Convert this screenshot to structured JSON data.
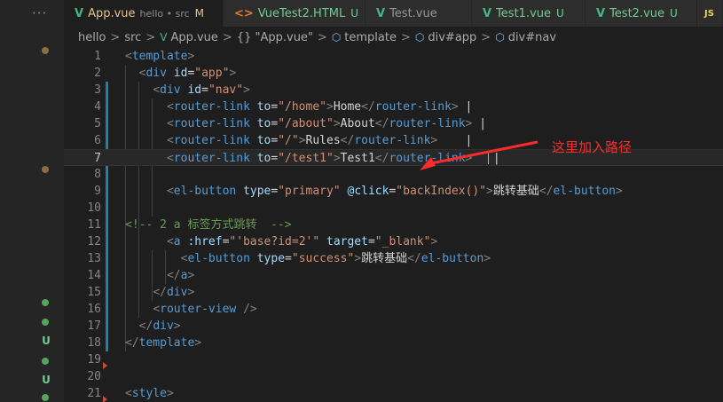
{
  "explorer_strip": {
    "more_dots": "···",
    "status_letters": [
      "U",
      "U"
    ]
  },
  "tabs": [
    {
      "name": "App.vue",
      "description": "hello • src",
      "status": "M",
      "icon": "vue-icon",
      "active": true
    },
    {
      "name": "VueTest2.HTML",
      "description": "",
      "status": "U",
      "icon": "html-icon",
      "active": false
    },
    {
      "name": "Test.vue",
      "description": "",
      "status": "",
      "icon": "vue-icon",
      "active": false
    },
    {
      "name": "Test1.vue",
      "description": "",
      "status": "U",
      "icon": "vue-icon",
      "active": false
    },
    {
      "name": "Test2.vue",
      "description": "",
      "status": "U",
      "icon": "vue-icon",
      "active": false
    },
    {
      "name": "",
      "description": "",
      "status": "",
      "icon": "js-icon",
      "active": false
    }
  ],
  "tab_icon_glyphs": {
    "vue": "V",
    "html": "<>",
    "js": "JS",
    "close": "×"
  },
  "breadcrumb": {
    "segments": [
      "hello",
      "src",
      "App.vue",
      "{} \"App.vue\"",
      "template",
      "div#app",
      "div#nav"
    ],
    "separator": ">"
  },
  "editor": {
    "current_line": 7,
    "lines": [
      {
        "n": "1",
        "code": "<template>"
      },
      {
        "n": "2",
        "code": "  <div id=\"app\">"
      },
      {
        "n": "3",
        "code": "    <div id=\"nav\">"
      },
      {
        "n": "4",
        "code": "      <router-link to=\"/home\">Home</router-link> |"
      },
      {
        "n": "5",
        "code": "      <router-link to=\"/about\">About</router-link> |"
      },
      {
        "n": "6",
        "code": "      <router-link to=\"/\">Rules</router-link>    |"
      },
      {
        "n": "7",
        "code": "      <router-link to=\"/test1\">Test1</router-link>   |"
      },
      {
        "n": "8",
        "code": ""
      },
      {
        "n": "9",
        "code": "      <el-button type=\"primary\" @click=\"backIndex()\">跳转基础</el-button>"
      },
      {
        "n": "10",
        "code": ""
      },
      {
        "n": "11",
        "code": "<!-- 2 a 标签方式跳转  -->"
      },
      {
        "n": "12",
        "code": "      <a :href=\"'base?id=2'\" target=\"_blank\">"
      },
      {
        "n": "13",
        "code": "        <el-button type=\"success\">跳转基础</el-button>"
      },
      {
        "n": "14",
        "code": "      </a>"
      },
      {
        "n": "15",
        "code": "    </div>"
      },
      {
        "n": "16",
        "code": "    <router-view />"
      },
      {
        "n": "17",
        "code": "  </div>"
      },
      {
        "n": "18",
        "code": "</template>"
      },
      {
        "n": "19",
        "code": ""
      },
      {
        "n": "20",
        "code": ""
      },
      {
        "n": "21",
        "code": "<style>"
      }
    ]
  },
  "annotation": {
    "text": "这里加入路径",
    "color": "#ff2a2a"
  },
  "colors": {
    "tag": "#569cd6",
    "attribute": "#9cdcfe",
    "string": "#ce9178",
    "comment": "#6a9955",
    "modified": "#e2c08d",
    "untracked": "#73c991",
    "gutter_modified": "#1b81a8"
  }
}
